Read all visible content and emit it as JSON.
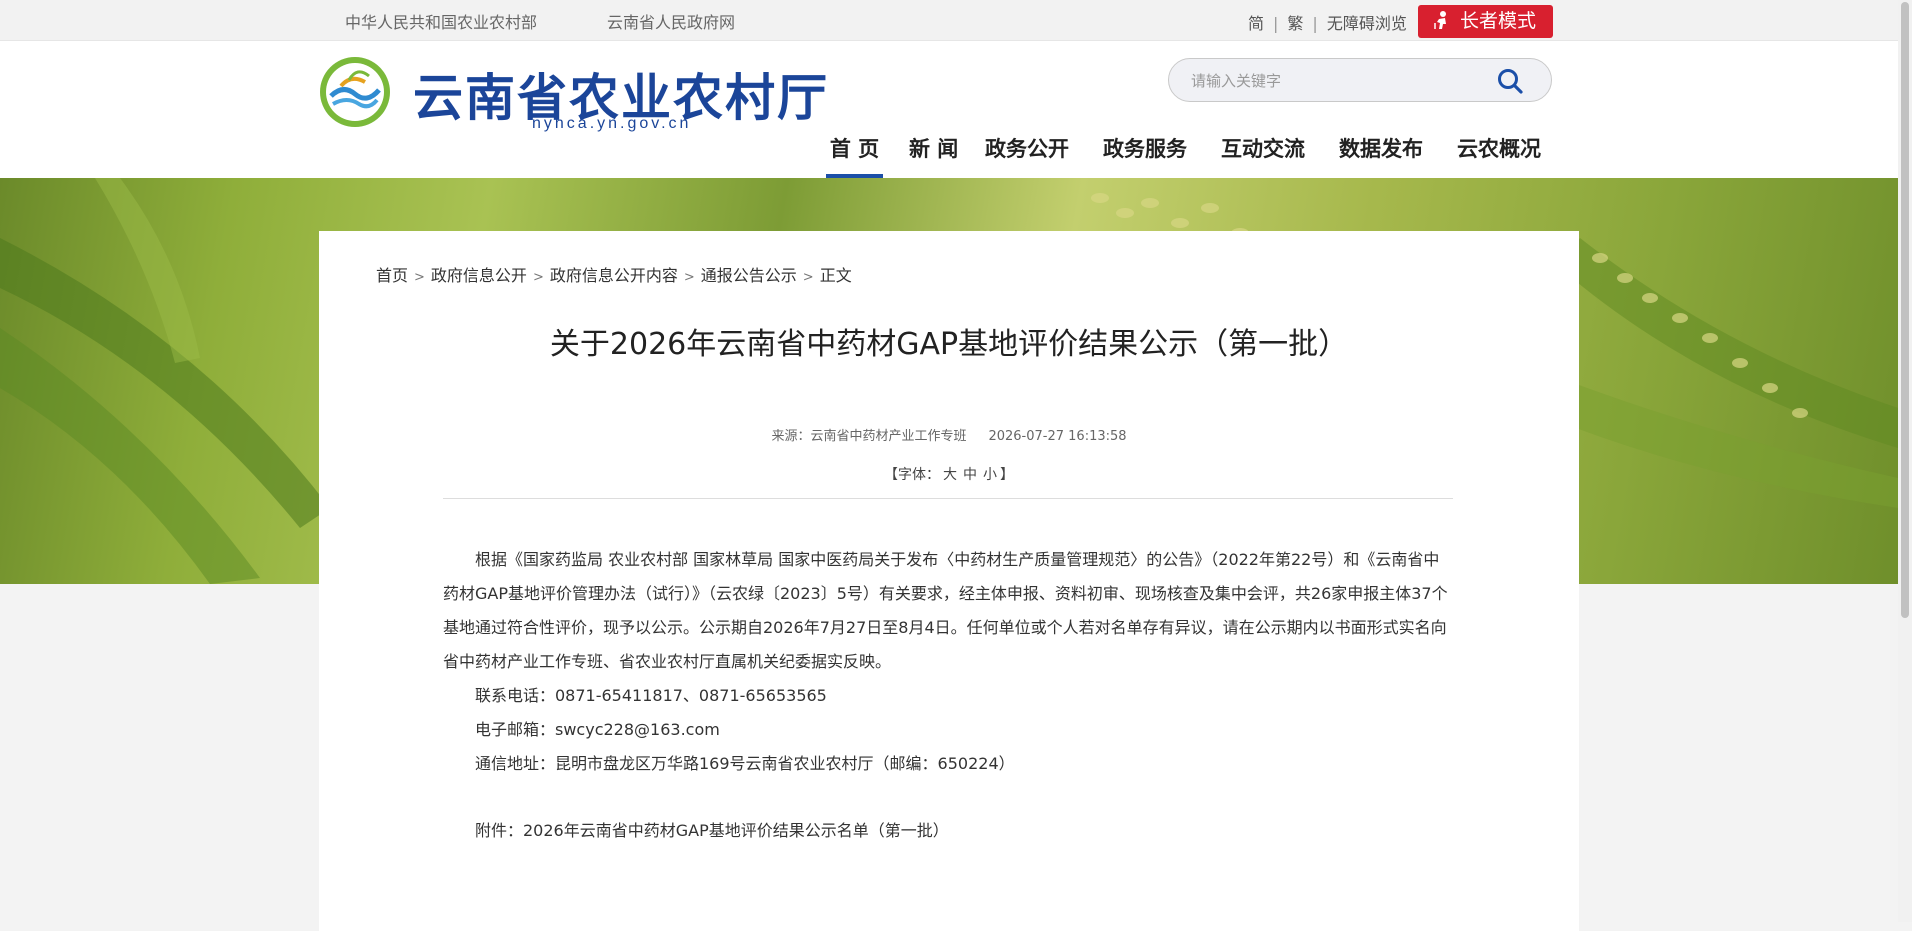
{
  "topbar": {
    "links": [
      "中华人民共和国农业农村部",
      "云南省人民政府网"
    ],
    "tools": [
      "简",
      "繁",
      "无障碍浏览"
    ],
    "elder_mode": "长者模式"
  },
  "header": {
    "site_title": "云南省农业农村厅",
    "site_domain": "nynca.yn.gov.cn",
    "search_placeholder": "请输入关键字"
  },
  "nav": {
    "items": [
      "首 页",
      "新 闻",
      "政务公开",
      "政务服务",
      "互动交流",
      "数据发布",
      "云农概况"
    ],
    "active_index": 0
  },
  "breadcrumb": [
    "首页",
    "政府信息公开",
    "政府信息公开内容",
    "通报公告公示",
    "正文"
  ],
  "article": {
    "title": "关于2026年云南省中药材GAP基地评价结果公示（第一批）",
    "source": "来源：云南省中药材产业工作专班",
    "datetime": "2026-07-27 16:13:58",
    "font_label_open": "【字体：",
    "font_sizes": [
      "大",
      "中",
      "小"
    ],
    "font_label_close": "】",
    "paragraph_1": "根据《国家药监局 农业农村部 国家林草局 国家中医药局关于发布〈中药材生产质量管理规范〉的公告》（2022年第22号）和《云南省中药材GAP基地评价管理办法（试行）》（云农绿〔2023〕5号）有关要求，经主体申报、资料初审、现场核查及集中会评，共26家申报主体37个基地通过符合性评价，现予以公示。公示期自2026年7月27日至8月4日。任何单位或个人若对名单存有异议，请在公示期内以书面形式实名向省中药材产业工作专班、省农业农村厅直属机关纪委据实反映。",
    "phone": "联系电话：0871-65411817、0871-65653565",
    "email": "电子邮箱：swcyc228@163.com",
    "address": "通信地址：昆明市盘龙区万华路169号云南省农业农村厅（邮编：650224）",
    "attachment": "附件：2026年云南省中药材GAP基地评价结果公示名单（第一批）"
  },
  "colors": {
    "brand_blue": "#1b4599",
    "elder_red": "#d8202f",
    "nav_active": "#1b4fa8"
  }
}
